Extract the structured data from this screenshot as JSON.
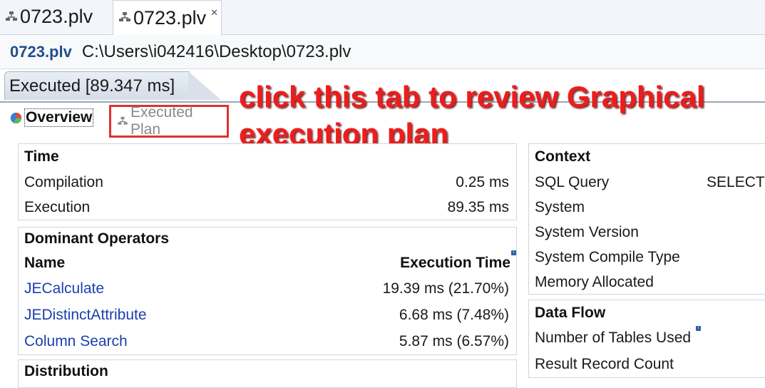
{
  "editor_tabs": [
    {
      "label": "0723.plv"
    },
    {
      "label": "0723.plv"
    }
  ],
  "path_bar": {
    "file_name": "0723.plv",
    "path": "C:\\Users\\i042416\\Desktop\\0723.plv"
  },
  "exec_tab": {
    "label": "Executed [89.347 ms]"
  },
  "sub_tabs": {
    "overview": "Overview",
    "executed_plan": "Executed Plan"
  },
  "annotation": {
    "line1": "click this tab to review Graphical",
    "line2": "execution plan"
  },
  "time_panel": {
    "title": "Time",
    "rows": [
      {
        "label": "Compilation",
        "value": "0.25 ms"
      },
      {
        "label": "Execution",
        "value": "89.35 ms"
      }
    ]
  },
  "dominant_panel": {
    "title": "Dominant Operators",
    "col_name": "Name",
    "col_time": "Execution Time",
    "rows": [
      {
        "name": "JECalculate",
        "time": "19.39 ms (21.70%)"
      },
      {
        "name": "JEDistinctAttribute",
        "time": "6.68 ms (7.48%)"
      },
      {
        "name": "Column Search",
        "time": "5.87 ms (6.57%)"
      }
    ]
  },
  "distribution_panel": {
    "title": "Distribution"
  },
  "context_panel": {
    "title": "Context",
    "rows": [
      {
        "label": "SQL Query",
        "value": "SELECT /"
      },
      {
        "label": "System",
        "value": ""
      },
      {
        "label": "System Version",
        "value": ""
      },
      {
        "label": "System Compile Type",
        "value": ""
      },
      {
        "label": "Memory Allocated",
        "value": ""
      }
    ]
  },
  "dataflow_panel": {
    "title": "Data Flow",
    "rows": [
      {
        "label": "Number of Tables Used"
      },
      {
        "label": "Result Record Count"
      }
    ]
  },
  "colors": {
    "annotation": "#ee1c1c",
    "link": "#1a3fb0",
    "highlight_box": "#e03030"
  }
}
